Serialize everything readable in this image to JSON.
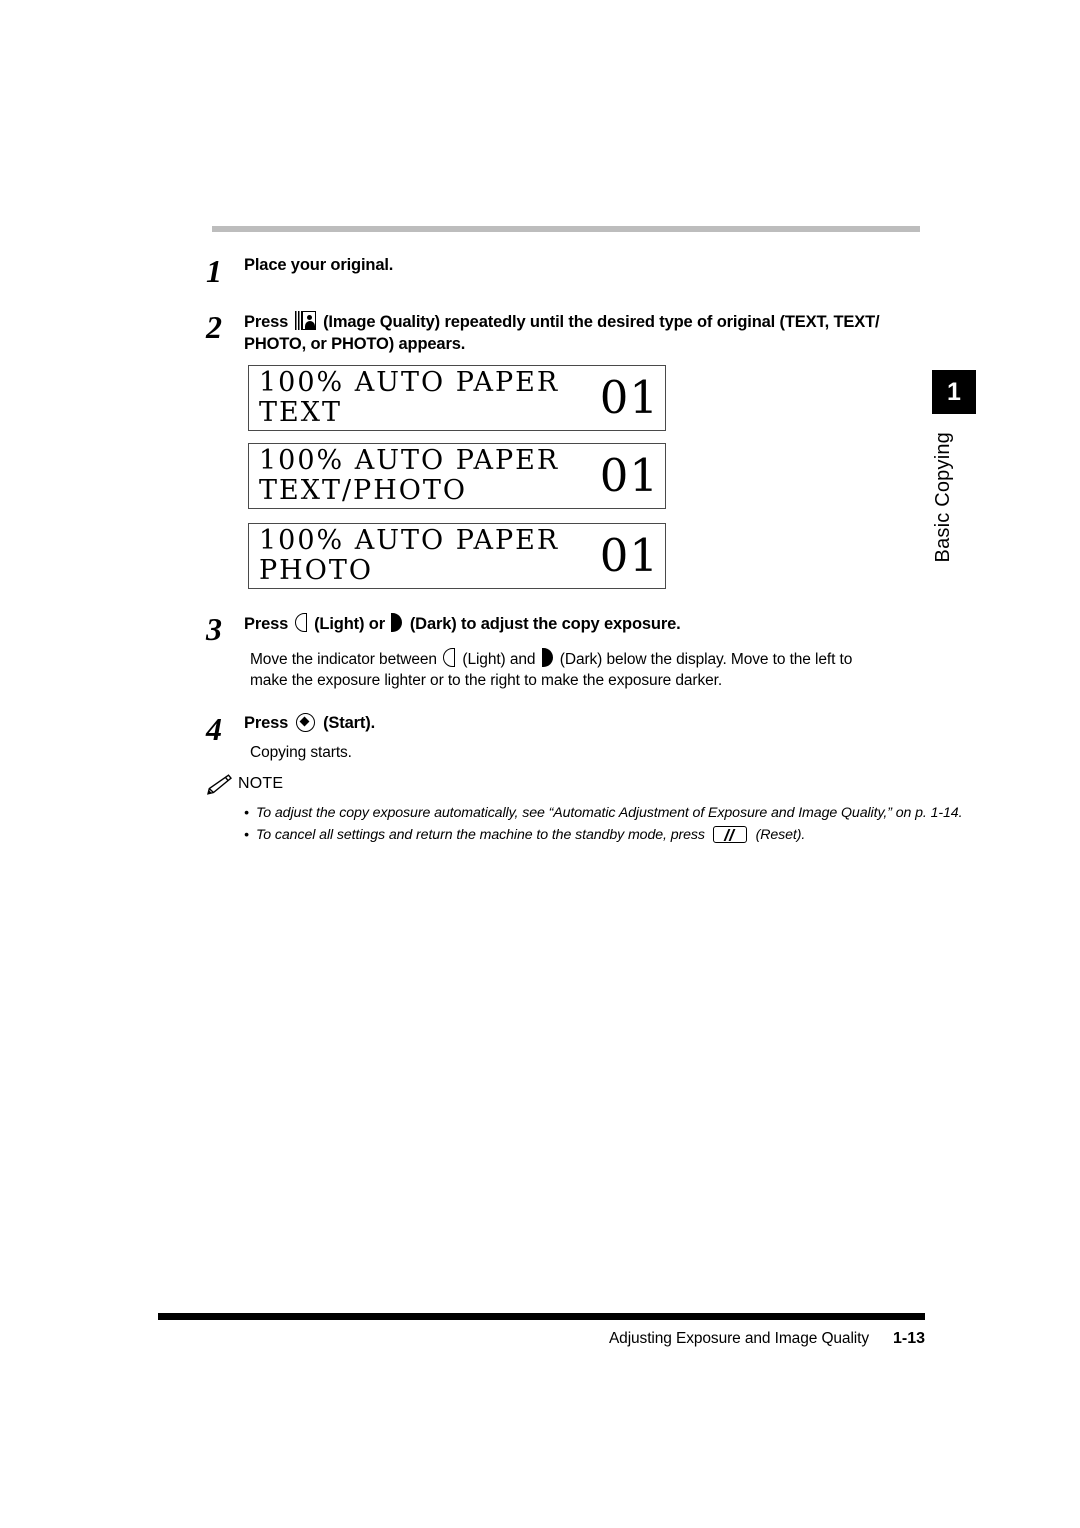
{
  "page": {
    "chapter_number": "1",
    "chapter_label": "Basic Copying",
    "footer_title": "Adjusting Exposure and Image Quality",
    "footer_page": "1-13"
  },
  "steps": [
    {
      "number": "1",
      "text": "Place your original."
    },
    {
      "number": "2",
      "text_before_icon": "Press ",
      "icon": "image-quality-icon",
      "text_after_icon": " (Image Quality) repeatedly until the desired type of original (TEXT, TEXT/ PHOTO, or PHOTO) appears."
    },
    {
      "number": "3",
      "heading_part1": "Press ",
      "heading_icon1": "light-icon",
      "heading_part2": " (Light) or ",
      "heading_icon2": "dark-icon",
      "heading_part3": " (Dark) to adjust the copy exposure.",
      "sub_part1": "Move the indicator between ",
      "sub_icon1": "light-icon",
      "sub_part2": " (Light) and ",
      "sub_icon2": "dark-icon",
      "sub_part3": " (Dark) below the display. Move to the left to make the exposure lighter or to the right to make the exposure darker."
    },
    {
      "number": "4",
      "heading_part1": "Press ",
      "heading_icon1": "start-icon",
      "heading_part2": " (Start).",
      "sub_text": "Copying starts."
    }
  ],
  "displays": [
    {
      "line1": "100% AUTO PAPER",
      "line2": "TEXT",
      "counter": "01"
    },
    {
      "line1": "100% AUTO PAPER",
      "line2": "TEXT/PHOTO",
      "counter": "01"
    },
    {
      "line1": "100% AUTO PAPER",
      "line2": "PHOTO",
      "counter": "01"
    }
  ],
  "note": {
    "icon": "pencil-icon",
    "label": "NOTE",
    "bullet": "•",
    "items": [
      {
        "text": "To adjust the copy exposure automatically, see “Automatic Adjustment of Exposure and Image Quality,” on p. 1-14."
      },
      {
        "part1": "To cancel all settings and return the machine to the standby mode, press ",
        "icon": "reset-icon",
        "part2": " (Reset)."
      }
    ]
  },
  "colors": {
    "top_rule": "#bdbdbd",
    "bottom_rule": "#000000",
    "lcd_border": "#4a4a4a",
    "tab_background": "#000000"
  }
}
